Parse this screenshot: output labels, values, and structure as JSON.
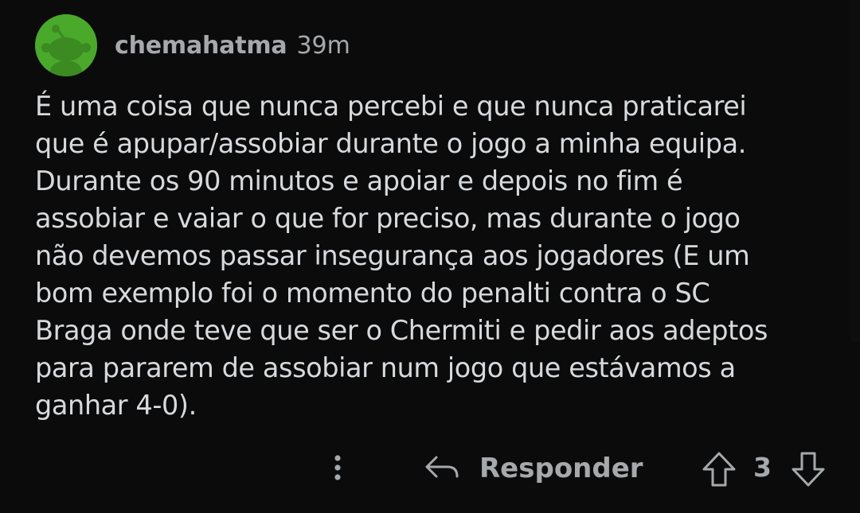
{
  "comment": {
    "author": "chemahatma",
    "time": "39m",
    "body": "É uma coisa que nunca percebi e que nunca praticarei\nque é apupar/assobiar durante o jogo a minha equipa.\nDurante os 90 minutos e apoiar e depois no fim é\nassobiar e vaiar o que for preciso, mas durante o jogo\nnão devemos passar insegurança aos jogadores (E um\nbom exemplo foi o momento do penalti contra o SC\nBraga onde teve que ser o Chermiti e pedir aos adeptos\npara pararem de assobiar num jogo que estávamos a\nganhar 4-0).",
    "avatar_icon": "snoo-avatar-icon",
    "avatar_color": "#4aa82b"
  },
  "actions": {
    "more_icon": "vertical-dots-icon",
    "reply_icon": "reply-arrow-icon",
    "reply_label": "Responder",
    "upvote_icon": "arrow-up-icon",
    "vote_count": "3",
    "downvote_icon": "arrow-down-icon"
  },
  "colors": {
    "background": "#0b0b0c",
    "text": "#d7dadc",
    "muted": "#a6a9ab"
  }
}
